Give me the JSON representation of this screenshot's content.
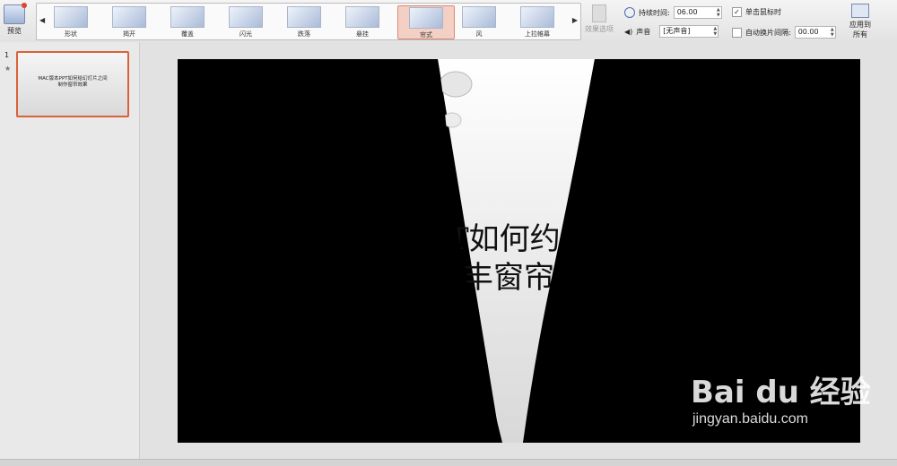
{
  "toolbar": {
    "preview_label": "预览",
    "effects_label": "效果选项",
    "duration_label": "持续时间:",
    "duration_value": "06.00",
    "sound_label": "声音",
    "sound_value": "[无声音]",
    "on_click_label": "单击鼠标时",
    "on_click_checked": true,
    "auto_after_label": "自动换片间隔:",
    "auto_after_value": "00.00",
    "apply_all_label": "应用到所有"
  },
  "transitions": [
    {
      "name": "形状",
      "selected": false
    },
    {
      "name": "揭开",
      "selected": false
    },
    {
      "name": "覆盖",
      "selected": false
    },
    {
      "name": "闪光",
      "selected": false
    },
    {
      "name": "跌落",
      "selected": false
    },
    {
      "name": "悬挂",
      "selected": false
    },
    {
      "name": "帘式",
      "selected": true
    },
    {
      "name": "风",
      "selected": false
    },
    {
      "name": "上拉帷幕",
      "selected": false
    }
  ],
  "slides_panel": {
    "slide_number": "1",
    "thumb_title_line1": "MAC版本PPT如何给幻灯片之间",
    "thumb_title_line2": "制作窗帘效果"
  },
  "slide": {
    "visible_text_line1": "T如何约",
    "visible_text_line2": "丰窗帘"
  },
  "watermark": {
    "main": "Bai du 经验",
    "url": "jingyan.baidu.com"
  },
  "colors": {
    "selected_transition": "#f4cfc3",
    "thumb_border": "#d9623b"
  }
}
